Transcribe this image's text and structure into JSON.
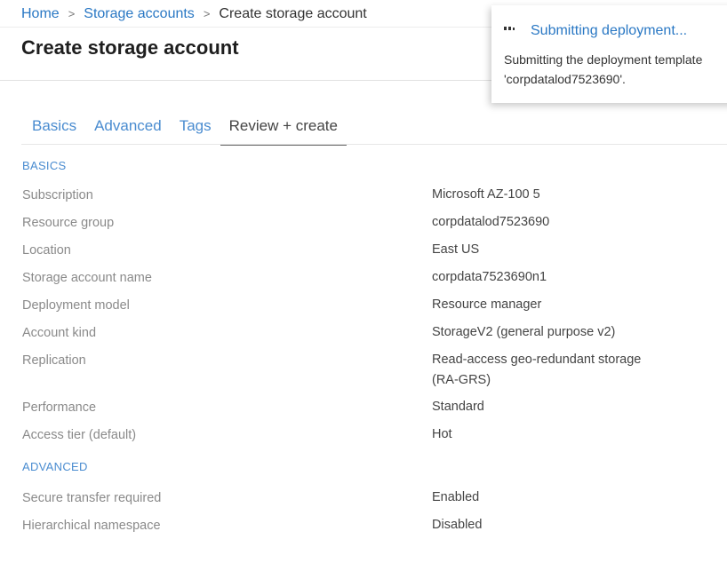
{
  "breadcrumb": {
    "home": "Home",
    "storage_accounts": "Storage accounts",
    "current": "Create storage account",
    "separator": ">"
  },
  "page": {
    "title": "Create storage account"
  },
  "tabs": [
    {
      "label": "Basics",
      "active": false
    },
    {
      "label": "Advanced",
      "active": false
    },
    {
      "label": "Tags",
      "active": false
    },
    {
      "label": "Review + create",
      "active": true
    }
  ],
  "sections": {
    "basics": {
      "heading": "BASICS",
      "rows": [
        {
          "label": "Subscription",
          "value": "Microsoft AZ-100 5"
        },
        {
          "label": "Resource group",
          "value": "corpdatalod7523690"
        },
        {
          "label": "Location",
          "value": "East US"
        },
        {
          "label": "Storage account name",
          "value": "corpdata7523690n1"
        },
        {
          "label": "Deployment model",
          "value": "Resource manager"
        },
        {
          "label": "Account kind",
          "value": "StorageV2 (general purpose v2)"
        },
        {
          "label": "Replication",
          "value": "Read-access geo-redundant storage (RA-GRS)"
        },
        {
          "label": "Performance",
          "value": "Standard"
        },
        {
          "label": "Access tier (default)",
          "value": "Hot"
        }
      ]
    },
    "advanced": {
      "heading": "ADVANCED",
      "rows": [
        {
          "label": "Secure transfer required",
          "value": "Enabled"
        },
        {
          "label": "Hierarchical namespace",
          "value": "Disabled"
        }
      ]
    }
  },
  "notification": {
    "icon": "in-progress-dots-icon",
    "title": "Submitting deployment...",
    "body_line1": "Submitting the deployment template",
    "body_line2": "'corpdatalod7523690'."
  },
  "colors": {
    "link": "#2a78c4",
    "tab": "#4a8cd0",
    "label": "#8a8a8a",
    "value": "#444444"
  }
}
